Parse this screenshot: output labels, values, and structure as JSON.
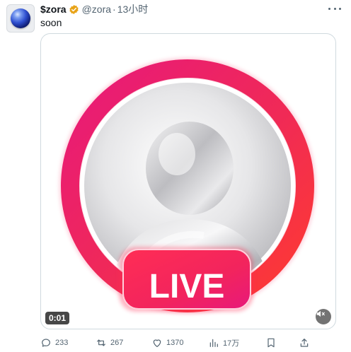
{
  "tweet": {
    "display_name": "$zora",
    "handle": "@zora",
    "separator": "·",
    "time": "13小时",
    "text": "soon",
    "verified_color": "#e8a317"
  },
  "media": {
    "live_label": "LIVE",
    "timer": "0:01",
    "ring_gradient": [
      "#e91e63",
      "#ff3b4a"
    ],
    "badge_gradient": [
      "#ff2d55",
      "#e8197a"
    ]
  },
  "actions": {
    "replies": "233",
    "reposts": "267",
    "likes": "1370",
    "views": "17万"
  },
  "icons": {
    "avatar": "zora-orb-avatar",
    "verified": "verified-badge-icon",
    "more": "more-icon",
    "mute": "mute-icon",
    "reply": "reply-icon",
    "repost": "repost-icon",
    "like": "heart-icon",
    "views": "views-icon",
    "bookmark": "bookmark-icon",
    "share": "share-icon"
  }
}
